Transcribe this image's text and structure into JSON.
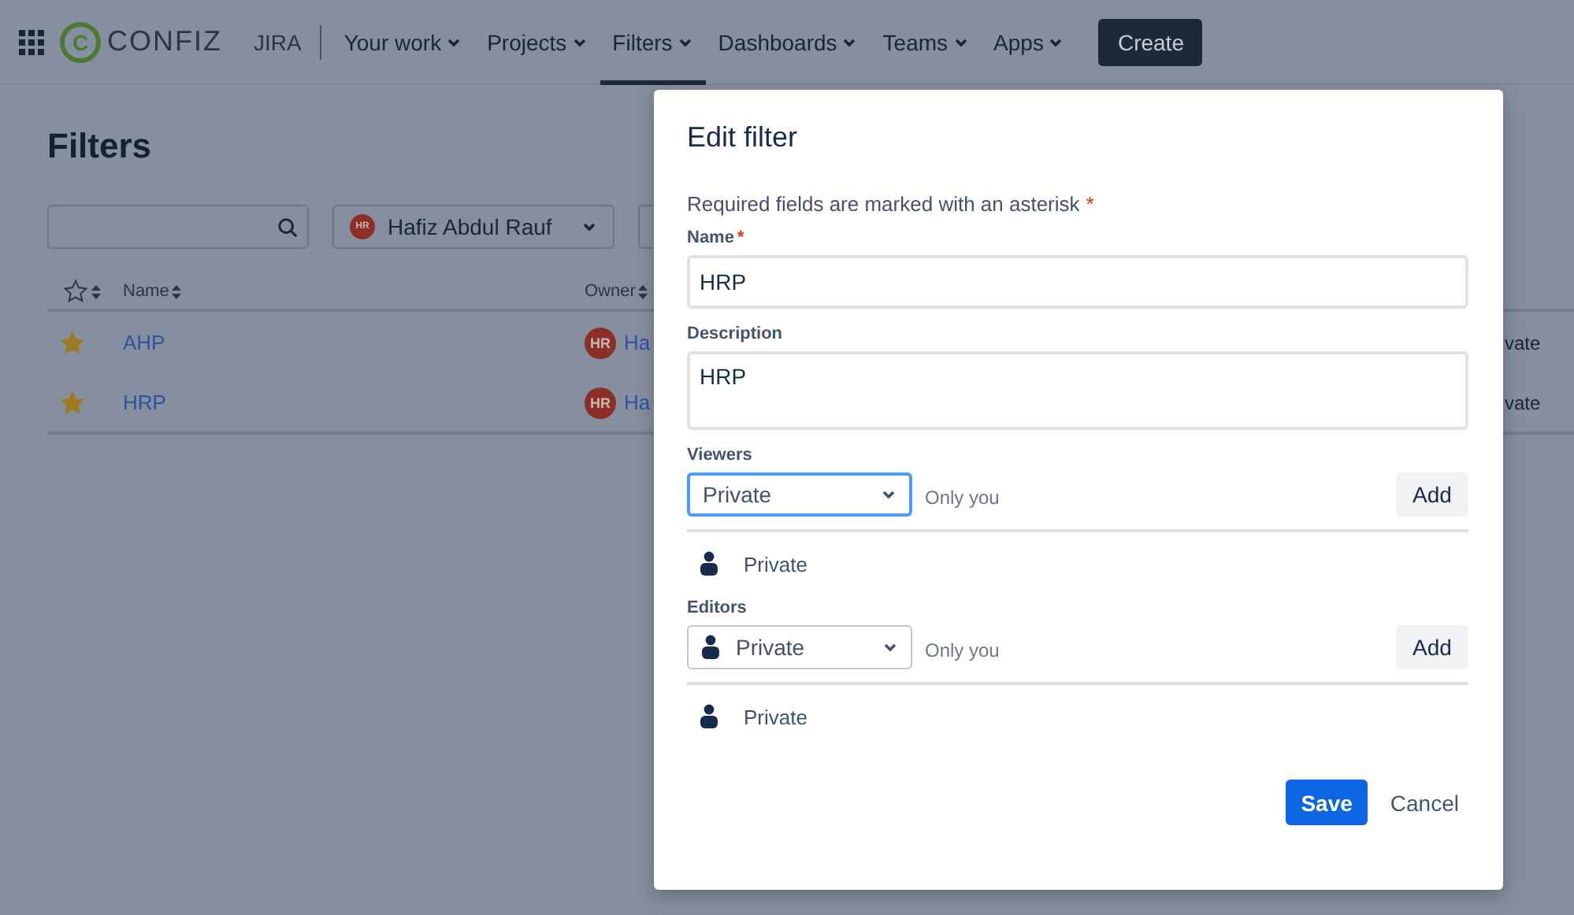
{
  "nav": {
    "logo": {
      "mark": "C",
      "name": "CONFIZ"
    },
    "product": "JIRA",
    "items": [
      {
        "label": "Your work",
        "selected": false
      },
      {
        "label": "Projects",
        "selected": false
      },
      {
        "label": "Filters",
        "selected": true
      },
      {
        "label": "Dashboards",
        "selected": false
      },
      {
        "label": "Teams",
        "selected": false
      },
      {
        "label": "Apps",
        "selected": false
      }
    ],
    "create_label": "Create"
  },
  "page": {
    "title": "Filters",
    "owner_filter": {
      "initials": "HR",
      "name": "Hafiz Abdul Rauf"
    },
    "columns": [
      {
        "label": "Name"
      },
      {
        "label": "Owner"
      }
    ],
    "rows": [
      {
        "starred": true,
        "name": "AHP",
        "owner_initials": "HR",
        "owner": "Ha",
        "column_4": "vate"
      },
      {
        "starred": true,
        "name": "HRP",
        "owner_initials": "HR",
        "owner": "Ha",
        "column_4": "vate"
      }
    ]
  },
  "dialog": {
    "title": "Edit filter",
    "required_note": "Required fields are marked with an asterisk",
    "required_mark": "*",
    "name": {
      "label": "Name",
      "required": true,
      "value": "HRP"
    },
    "description": {
      "label": "Description",
      "value": "HRP"
    },
    "sections": [
      {
        "label": "Viewers",
        "select": {
          "value": "Private",
          "focused": true,
          "show_icon": false
        },
        "hint": "Only you",
        "add_label": "Add",
        "entries": [
          {
            "label": "Private"
          }
        ]
      },
      {
        "label": "Editors",
        "select": {
          "value": "Private",
          "focused": false,
          "show_icon": true
        },
        "hint": "Only you",
        "add_label": "Add",
        "entries": [
          {
            "label": "Private"
          }
        ]
      }
    ],
    "save_label": "Save",
    "cancel_label": "Cancel"
  }
}
